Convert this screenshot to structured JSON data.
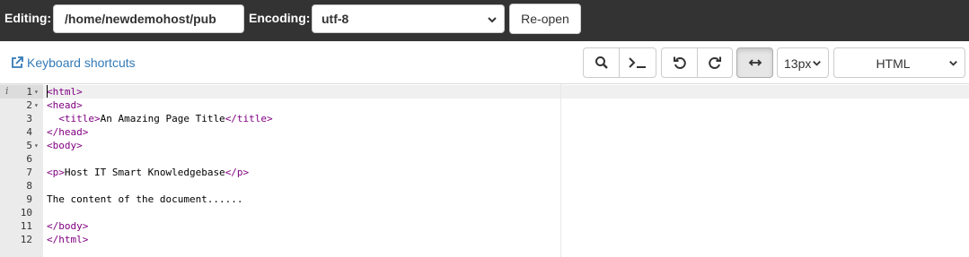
{
  "topbar": {
    "editing_label": "Editing:",
    "path": "/home/newdemohost/pub",
    "encoding_label": "Encoding:",
    "encoding_value": "utf-8",
    "reopen_label": "Re-open"
  },
  "toolbar": {
    "keyboard_shortcuts": "Keyboard shortcuts",
    "font_size": "13px",
    "mode": "HTML",
    "buttons": [
      "search-icon",
      "terminal-icon",
      "undo-icon",
      "redo-icon",
      "wrap-arrows-icon"
    ]
  },
  "editor": {
    "lines": [
      {
        "num": "1",
        "fold": "▾",
        "tokens": [
          {
            "t": "<html>",
            "c": "tag"
          }
        ]
      },
      {
        "num": "2",
        "fold": "▾",
        "tokens": [
          {
            "t": "<head>",
            "c": "tag"
          }
        ]
      },
      {
        "num": "3",
        "fold": "",
        "tokens": [
          {
            "t": "  ",
            "c": ""
          },
          {
            "t": "<title>",
            "c": "tag"
          },
          {
            "t": "An Amazing Page Title",
            "c": ""
          },
          {
            "t": "</title>",
            "c": "tag"
          }
        ]
      },
      {
        "num": "4",
        "fold": "",
        "tokens": [
          {
            "t": "</head>",
            "c": "tag"
          }
        ]
      },
      {
        "num": "5",
        "fold": "▾",
        "tokens": [
          {
            "t": "<body>",
            "c": "tag"
          }
        ]
      },
      {
        "num": "6",
        "fold": "",
        "tokens": []
      },
      {
        "num": "7",
        "fold": "",
        "tokens": [
          {
            "t": "<p>",
            "c": "tag"
          },
          {
            "t": "Host IT Smart Knowledgebase",
            "c": ""
          },
          {
            "t": "</p>",
            "c": "tag"
          }
        ]
      },
      {
        "num": "8",
        "fold": "",
        "tokens": []
      },
      {
        "num": "9",
        "fold": "",
        "tokens": [
          {
            "t": "The content of the document......",
            "c": ""
          }
        ]
      },
      {
        "num": "10",
        "fold": "",
        "tokens": []
      },
      {
        "num": "11",
        "fold": "",
        "tokens": [
          {
            "t": "</body>",
            "c": "tag"
          }
        ]
      },
      {
        "num": "12",
        "fold": "",
        "tokens": [
          {
            "t": "</html>",
            "c": "tag"
          }
        ]
      }
    ]
  },
  "colors": {
    "topbar": "#333333",
    "link": "#337ab7",
    "tag": "#800080",
    "gutter": "#ebebeb"
  }
}
